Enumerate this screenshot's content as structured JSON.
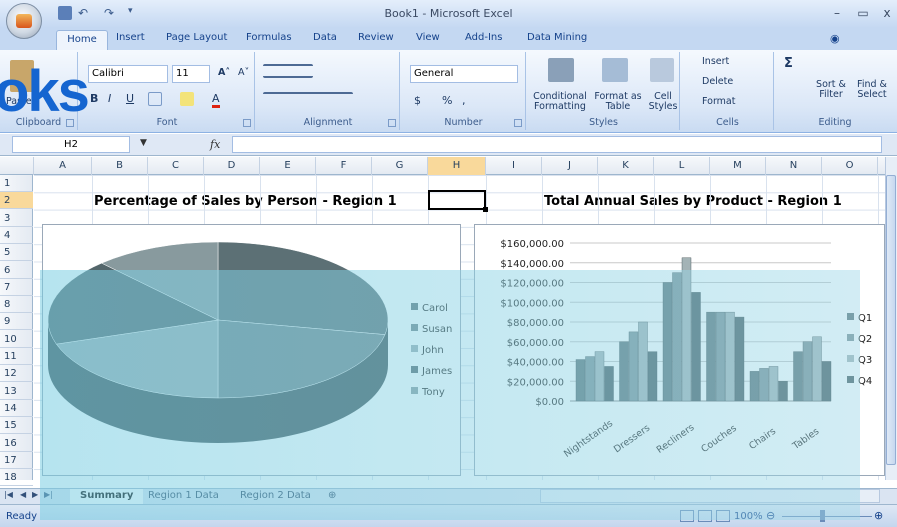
{
  "window": {
    "title": "Book1 - Microsoft Excel",
    "minimize": "–",
    "maximize": "▭",
    "close": "x"
  },
  "ribbon": {
    "tabs": [
      "Home",
      "Insert",
      "Page Layout",
      "Formulas",
      "Data",
      "Review",
      "View",
      "Add-Ins",
      "Data Mining"
    ],
    "active_tab": "Home",
    "brand_overlay": "oks",
    "clipboard": {
      "label": "Clipboard",
      "paste": "Paste"
    },
    "font": {
      "label": "Font",
      "name": "Calibri",
      "size": "11",
      "bold": "B",
      "italic": "I",
      "underline": "U",
      "grow": "A˄",
      "shrink": "A˅",
      "color_a": "A"
    },
    "alignment": {
      "label": "Alignment"
    },
    "number": {
      "label": "Number",
      "format": "General",
      "currency": "$",
      "percent": "%",
      "comma": ","
    },
    "styles": {
      "label": "Styles",
      "conditional": "Conditional Formatting",
      "format_table": "Format as Table",
      "cell_styles": "Cell Styles"
    },
    "cells": {
      "label": "Cells",
      "insert": "Insert",
      "delete": "Delete",
      "format": "Format"
    },
    "editing": {
      "label": "Editing",
      "sum": "Σ",
      "sort": "Sort & Filter",
      "find": "Find & Select"
    }
  },
  "formula_bar": {
    "name_box": "H2",
    "fx": "fx",
    "value": ""
  },
  "columns": [
    "A",
    "B",
    "C",
    "D",
    "E",
    "F",
    "G",
    "H",
    "I",
    "J",
    "K",
    "L",
    "M",
    "N",
    "O"
  ],
  "rows": [
    "1",
    "2",
    "3",
    "4",
    "5",
    "6",
    "7",
    "8",
    "9",
    "10",
    "11",
    "12",
    "13",
    "14",
    "15",
    "16",
    "17",
    "18"
  ],
  "sheet": {
    "pie_title": "Percentage of Sales by Person - Region 1",
    "bar_title": "Total Annual Sales by Product - Region 1"
  },
  "colors": {
    "watermark": "#7fd0e4",
    "pie_dark": "#4e6166",
    "pie_mid": "#7e959a",
    "pie_light": "#a7b5b8"
  },
  "chart_data": [
    {
      "type": "pie",
      "title": "Percentage of Sales by Person - Region 1",
      "categories": [
        "Carol",
        "Susan",
        "John",
        "James",
        "Tony"
      ],
      "values": [
        28,
        22,
        20,
        18,
        12
      ],
      "legend": "right"
    },
    {
      "type": "bar",
      "title": "Total Annual Sales by Product - Region 1",
      "categories": [
        "Nightstands",
        "Dressers",
        "Recliners",
        "Couches",
        "Chairs",
        "Tables"
      ],
      "series": [
        {
          "name": "Q1",
          "values": [
            42000,
            60000,
            120000,
            90000,
            30000,
            50000
          ]
        },
        {
          "name": "Q2",
          "values": [
            45000,
            70000,
            130000,
            90000,
            33000,
            60000
          ]
        },
        {
          "name": "Q3",
          "values": [
            50000,
            80000,
            145000,
            90000,
            35000,
            65000
          ]
        },
        {
          "name": "Q4",
          "values": [
            35000,
            50000,
            110000,
            85000,
            20000,
            40000
          ]
        }
      ],
      "y_ticks": [
        "$160,000.00",
        "$140,000.00",
        "$120,000.00",
        "$100,000.00",
        "$80,000.00",
        "$60,000.00",
        "$40,000.00",
        "$20,000.00",
        "$0.00"
      ],
      "ylim": [
        0,
        160000
      ],
      "legend": "right",
      "grid": true
    }
  ],
  "sheet_tabs": [
    "Summary",
    "Region 1 Data",
    "Region 2 Data"
  ],
  "status": {
    "ready": "Ready",
    "zoom": "100%"
  }
}
